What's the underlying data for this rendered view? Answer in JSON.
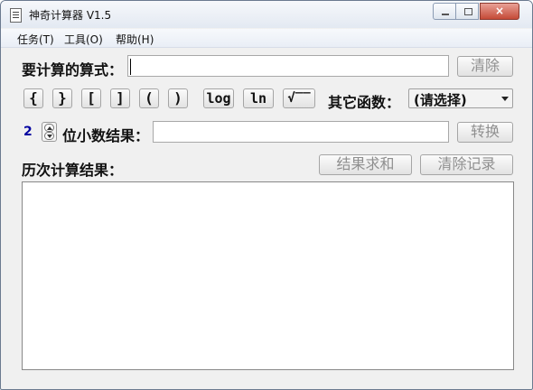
{
  "window": {
    "title": "神奇计算器 V1.5",
    "close_label": "×"
  },
  "menu": {
    "items": [
      {
        "label": "任务(T)"
      },
      {
        "label": "工具(O)"
      },
      {
        "label": "帮助(H)"
      }
    ]
  },
  "formula": {
    "label": "要计算的算式：",
    "value": "",
    "clear_label": "清除"
  },
  "symbols": [
    {
      "label": "{"
    },
    {
      "label": "}"
    },
    {
      "label": "["
    },
    {
      "label": "]"
    },
    {
      "label": "("
    },
    {
      "label": ")"
    },
    {
      "label": "log"
    },
    {
      "label": "ln"
    },
    {
      "label": "√‾‾"
    }
  ],
  "functions": {
    "label": "其它函数：",
    "selected": "(请选择)"
  },
  "precision": {
    "value": "2",
    "label": "位小数结果：",
    "convert_label": "转换"
  },
  "history": {
    "label": "历次计算结果：",
    "sum_label": "结果求和",
    "clear_label": "清除记录"
  }
}
